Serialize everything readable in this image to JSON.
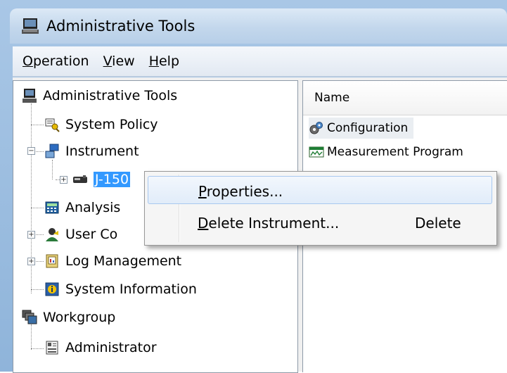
{
  "window": {
    "title": "Administrative Tools",
    "app_icon": "computer-icon"
  },
  "menubar": {
    "items": [
      {
        "mnemonic": "O",
        "rest": "peration"
      },
      {
        "mnemonic": "V",
        "rest": "iew"
      },
      {
        "mnemonic": "H",
        "rest": "elp"
      }
    ]
  },
  "tree": {
    "root": "Administrative Tools",
    "system_policy": "System Policy",
    "instrument": "Instrument",
    "instrument_child": "J-150",
    "analysis": "Analysis",
    "user_control": "User Co",
    "log_management": "Log Management",
    "system_information": "System Information",
    "workgroup": "Workgroup",
    "administrator": "Administrator"
  },
  "list": {
    "column_header": "Name",
    "items": [
      "Configuration",
      "Measurement Program"
    ]
  },
  "context_menu": {
    "properties": {
      "mnemonic": "P",
      "rest": "roperties..."
    },
    "delete": {
      "mnemonic": "D",
      "rest": "elete Instrument...",
      "shortcut": "Delete"
    }
  }
}
